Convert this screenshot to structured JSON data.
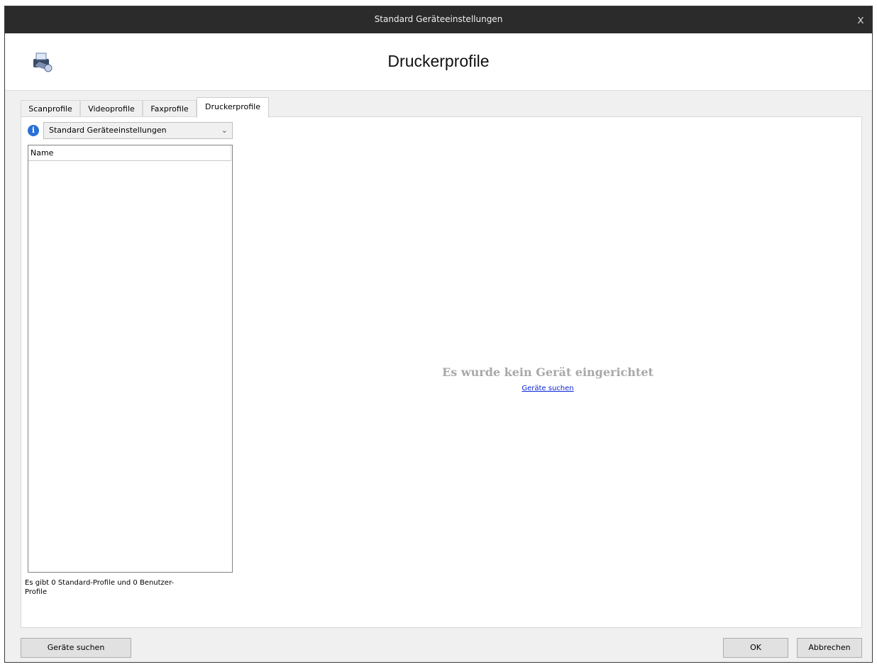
{
  "window": {
    "title": "Standard Geräteeinstellungen",
    "close_glyph": "x"
  },
  "header": {
    "heading": "Druckerprofile",
    "logo_icon": "printer-device-icon"
  },
  "tabs": [
    {
      "label": "Scanprofile",
      "active": false
    },
    {
      "label": "Videoprofile",
      "active": false
    },
    {
      "label": "Faxprofile",
      "active": false
    },
    {
      "label": "Druckerprofile",
      "active": true
    }
  ],
  "profile_select": {
    "value": "Standard Geräteeinstellungen"
  },
  "list": {
    "column_header": "Name"
  },
  "count_text": "Es gibt 0 Standard-Profile und 0 Benutzer-Profile",
  "empty_state": {
    "message": "Es wurde kein Gerät eingerichtet",
    "link": "Geräte suchen"
  },
  "footer": {
    "search_button": "Geräte suchen",
    "ok_button": "OK",
    "cancel_button": "Abbrechen"
  },
  "colors": {
    "titlebar": "#2b2b2b",
    "link": "#0a25d8",
    "info_icon": "#2a6fd6",
    "empty_text": "#a8a8a8"
  }
}
